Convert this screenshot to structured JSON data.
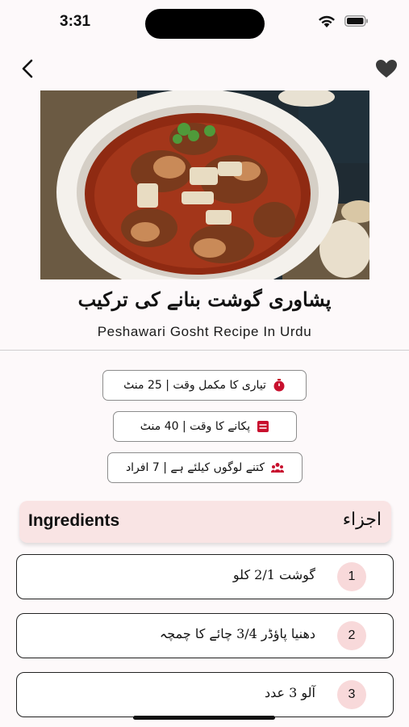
{
  "status": {
    "time": "3:31"
  },
  "recipe": {
    "title_urdu": "پشاوری گوشت بنانے کی ترکیب",
    "title_english": "Peshawari Gosht Recipe In Urdu"
  },
  "info": [
    {
      "text": "تیاری کا مکمل وقت | 25 منٹ",
      "icon": "stopwatch-icon"
    },
    {
      "text": "پکانے کا وقت | 40 منٹ",
      "icon": "calendar-icon"
    },
    {
      "text": "کتنے لوگوں کیلئے ہے | 7 افراد",
      "icon": "people-icon"
    }
  ],
  "ingredients": {
    "header_en": "Ingredients",
    "header_ur": "اجزاء",
    "items": [
      {
        "num": "1",
        "text": "گوشت 2/1 کلو"
      },
      {
        "num": "2",
        "text": "دھنیا پاؤڈر 3/4 چائے کا چمچہ"
      },
      {
        "num": "3",
        "text": "آلو 3 عدد"
      }
    ]
  },
  "colors": {
    "accent": "#c8102e",
    "badge": "#f8d9da",
    "header_bg": "#f9e4e4"
  }
}
